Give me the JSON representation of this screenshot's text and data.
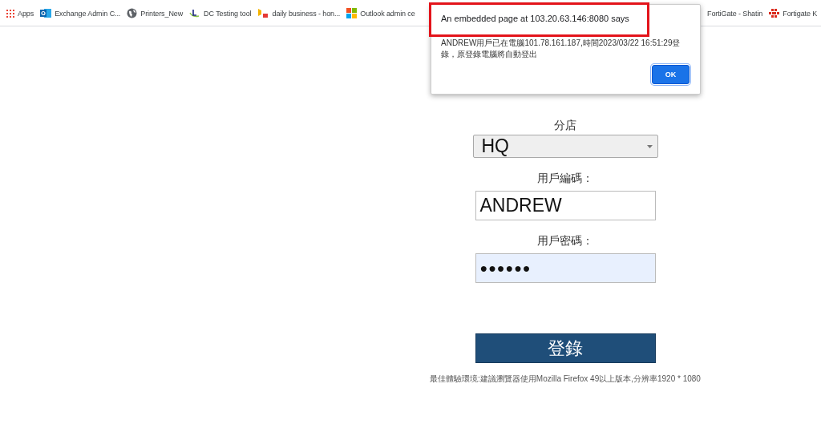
{
  "bookmarks": [
    {
      "label": "Apps",
      "kind": "apps"
    },
    {
      "label": "Exchange Admin C...",
      "kind": "outlook"
    },
    {
      "label": "Printers_New",
      "kind": "globe"
    },
    {
      "label": "DC Testing tool",
      "kind": "letter"
    },
    {
      "label": "daily business - hon...",
      "kind": "bing"
    },
    {
      "label": "Outlook admin ce",
      "kind": "windows"
    },
    {
      "label": "FortiGate - Shatin",
      "kind": "none"
    },
    {
      "label": "Fortigate K",
      "kind": "forti"
    }
  ],
  "form": {
    "branch_label": "分店",
    "branch_value": "HQ",
    "user_label": "用戶編碼：",
    "user_value": "ANDREW",
    "password_label": "用戶密碼：",
    "password_value": "●●●●●●",
    "password_focused": true,
    "login_button": "登錄",
    "footer": "最佳體驗環境:建議瀏覽器使用Mozilla Firefox 49以上版本,分辨率1920 * 1080"
  },
  "dialog": {
    "title": "An embedded page at 103.20.63.146:8080 says",
    "title_highlighted": true,
    "message": "ANDREW用戶已在電腦101.78.161.187,時間2023/03/22 16:51:29登錄，原登錄電腦將自動登出",
    "ok_button": "OK"
  }
}
